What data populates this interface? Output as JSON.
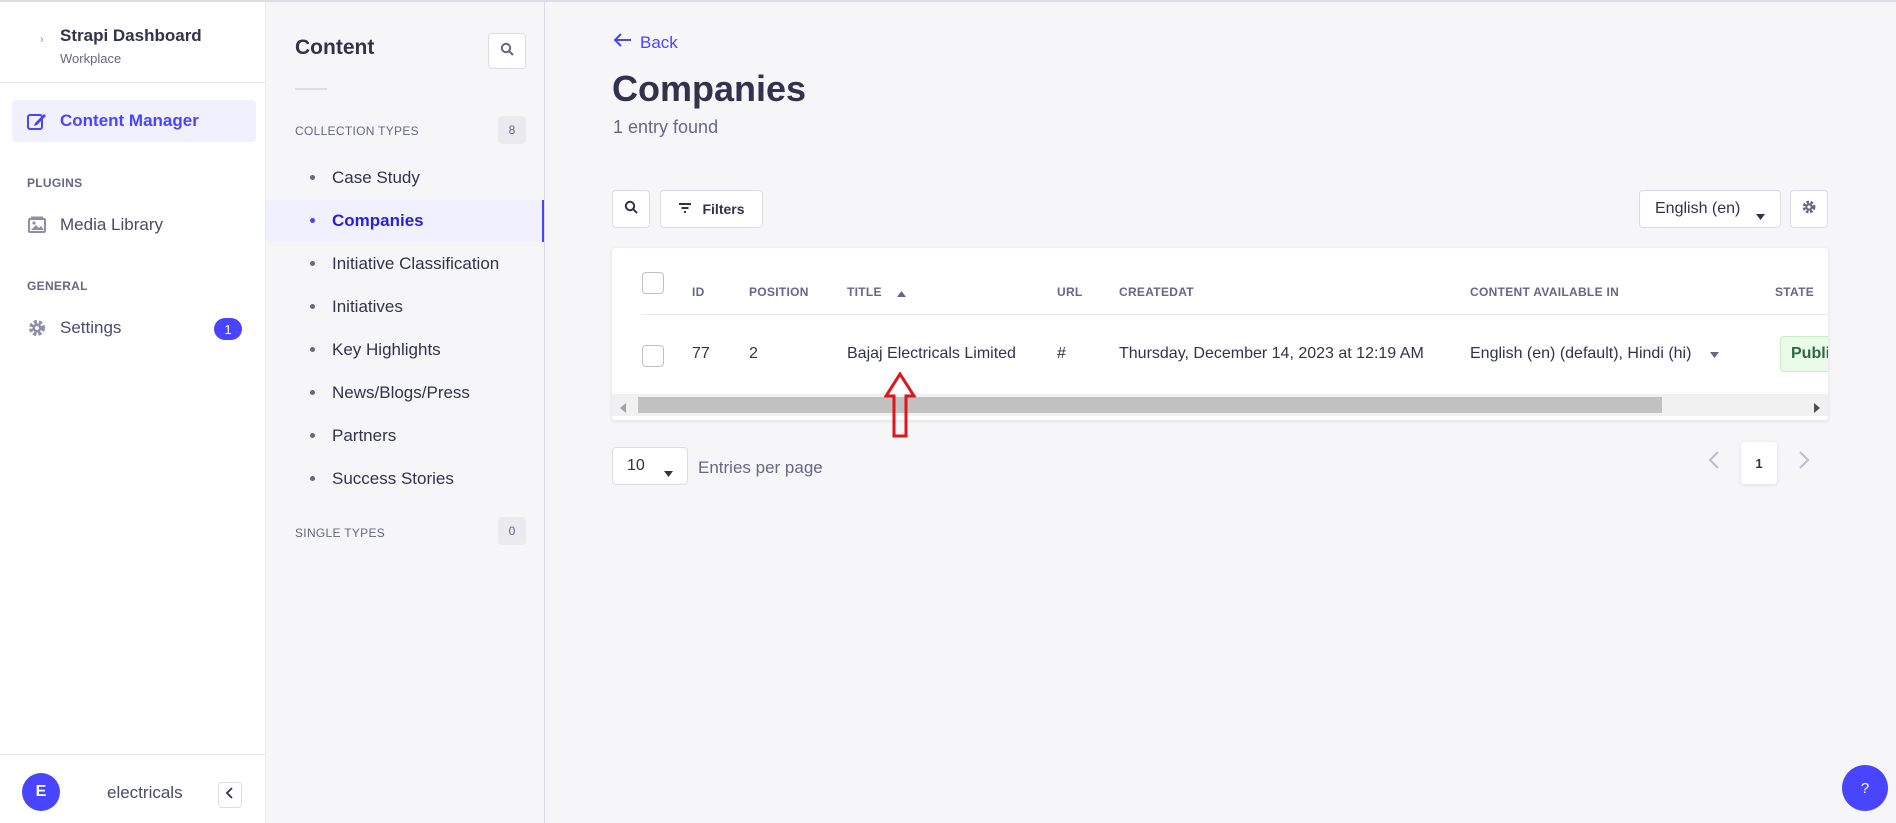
{
  "brand": {
    "title": "Strapi Dashboard",
    "subtitle": "Workplace"
  },
  "leftnav": {
    "content_manager": "Content Manager",
    "plugins_heading": "PLUGINS",
    "media_library": "Media Library",
    "general_heading": "GENERAL",
    "settings": "Settings",
    "settings_badge": "1"
  },
  "user": {
    "initial": "E",
    "name": "electricals"
  },
  "subnav": {
    "title": "Content",
    "collection_heading": "COLLECTION TYPES",
    "collection_count": "8",
    "items": [
      {
        "label": "Case Study"
      },
      {
        "label": "Companies"
      },
      {
        "label": "Initiative Classification"
      },
      {
        "label": "Initiatives"
      },
      {
        "label": "Key Highlights"
      },
      {
        "label": "News/Blogs/Press"
      },
      {
        "label": "Partners"
      },
      {
        "label": "Success Stories"
      }
    ],
    "single_heading": "SINGLE TYPES",
    "single_count": "0"
  },
  "main": {
    "back_label": "Back",
    "title": "Companies",
    "entry_count": "1 entry found",
    "filters_label": "Filters",
    "locale": "English (en)",
    "columns": {
      "id": "ID",
      "position": "POSITION",
      "title": "TITLE",
      "url": "URL",
      "createdat": "CREATEDAT",
      "content_available": "CONTENT AVAILABLE IN",
      "state": "STATE"
    },
    "rows": [
      {
        "id": "77",
        "position": "2",
        "title": "Bajaj Electricals Limited",
        "url": "#",
        "createdat": "Thursday, December 14, 2023 at 12:19 AM",
        "content_available": "English (en) (default), Hindi (hi)",
        "state": "Published"
      }
    ],
    "per_page": "10",
    "per_page_label": "Entries per page",
    "current_page": "1"
  },
  "help_label": "?",
  "colors": {
    "accent": "#4945ff",
    "annotation": "#e0151c"
  }
}
